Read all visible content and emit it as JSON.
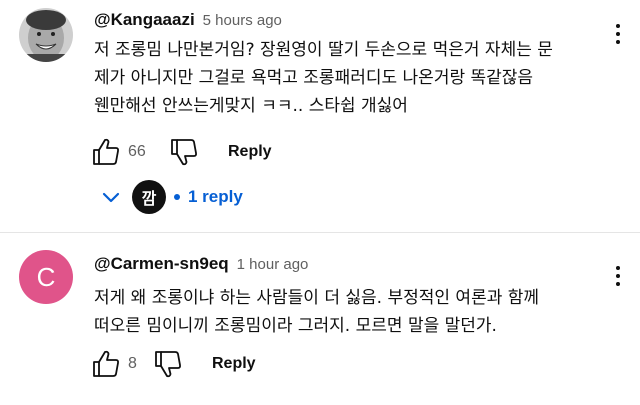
{
  "comments": [
    {
      "author": "@Kangaaazi",
      "time": "5 hours ago",
      "lines": [
        "저 조롱밈 나만본거임? 장원영이 딸기 두손으로 먹은거 자체는 문",
        "제가 아니지만 그걸로 욕먹고 조롱패러디도 나온거랑 똑같잖음",
        "웬만해선 안쓰는게맞지 ㅋㅋ.. 스타쉽 개싫어"
      ],
      "likes": "66",
      "reply_label": "Reply",
      "replies": {
        "avatar_text": "깜",
        "label": "1 reply"
      }
    },
    {
      "author": "@Carmen-sn9eq",
      "time": "1 hour ago",
      "avatar_letter": "C",
      "avatar_color": "#e0548a",
      "lines": [
        "저게 왜 조롱이냐 하는 사람들이 더 싫음. 부정적인 여론과 함께",
        "떠오른 밈이니끼 조롱밈이라 그러지. 모르면 말을 말던가."
      ],
      "likes": "8",
      "reply_label": "Reply"
    }
  ],
  "colors": {
    "link_blue": "#065fd4",
    "secondary_text": "#606060"
  }
}
